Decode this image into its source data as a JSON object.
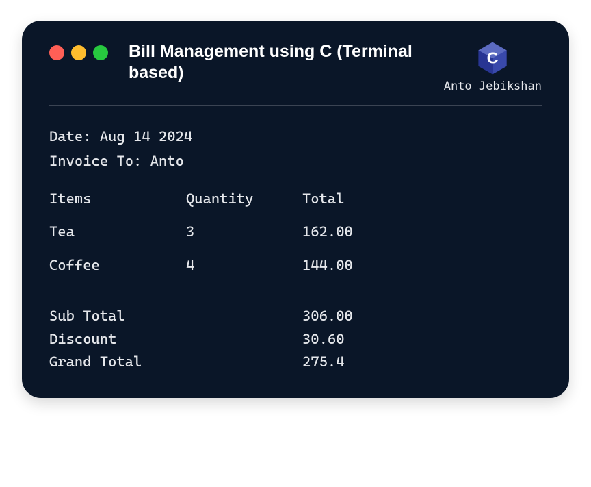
{
  "window": {
    "title": "Bill Management using C (Terminal based)",
    "author": "Anto Jebikshan",
    "logo": "c-lang-icon"
  },
  "invoice": {
    "date_label": "Date:",
    "date_value": "Aug 14 2024",
    "to_label": "Invoice To:",
    "to_value": "Anto"
  },
  "columns": {
    "items": "Items",
    "quantity": "Quantity",
    "total": "Total"
  },
  "lines": [
    {
      "item": "Tea",
      "qty": "3",
      "total": "162.00"
    },
    {
      "item": "Coffee",
      "qty": "4",
      "total": "144.00"
    }
  ],
  "totals": {
    "subtotal_label": "Sub Total",
    "subtotal_value": "306.00",
    "discount_label": "Discount",
    "discount_value": "30.60",
    "grand_label": "Grand Total",
    "grand_value": "275.4"
  }
}
